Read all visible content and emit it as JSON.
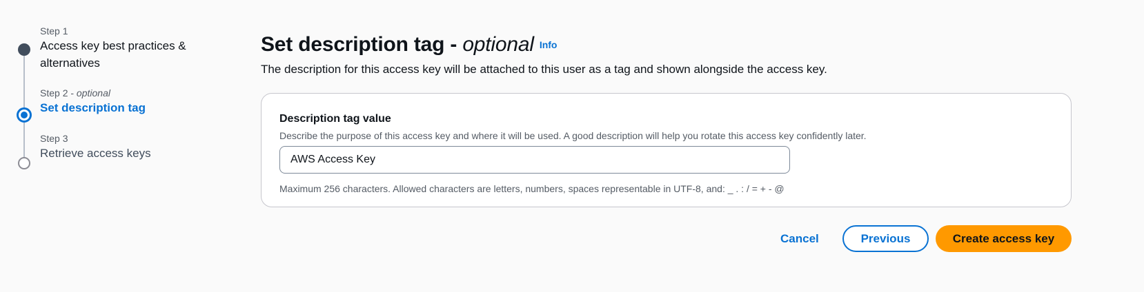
{
  "wizard": {
    "steps": [
      {
        "caption": "Step 1",
        "caption_optional": "",
        "title": "Access key best practices &",
        "title_line2": "alternatives",
        "state": "completed"
      },
      {
        "caption": "Step 2 - ",
        "caption_optional": "optional",
        "title": "Set description tag",
        "state": "current"
      },
      {
        "caption": "Step 3",
        "caption_optional": "",
        "title": "Retrieve access keys",
        "state": "upcoming"
      }
    ]
  },
  "header": {
    "title": "Set description tag - ",
    "title_optional": "optional",
    "info_link": "Info",
    "description": "The description for this access key will be attached to this user as a tag and shown alongside the access key."
  },
  "form": {
    "label": "Description tag value",
    "description": "Describe the purpose of this access key and where it will be used. A good description will help you rotate this access key confidently later.",
    "value": "AWS Access Key",
    "constraint": "Maximum 256 characters. Allowed characters are letters, numbers, spaces representable in UTF-8, and: _ . : / = + - @"
  },
  "actions": {
    "cancel": "Cancel",
    "previous": "Previous",
    "create": "Create access key"
  },
  "colors": {
    "accent": "#0972d3",
    "primary_button": "#ff9900",
    "completed_step": "#414d5c"
  }
}
